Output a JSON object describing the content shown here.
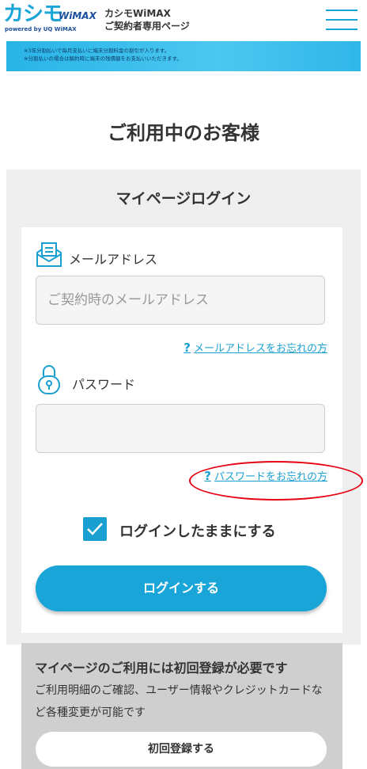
{
  "header": {
    "logo_main": "カシモ",
    "logo_wimax": "WiMAX",
    "logo_sub": "powered by UQ WiMAX",
    "site_title_line1": "カシモWiMAX",
    "site_title_line2": "ご契約者専用ページ",
    "menu_icon": "hamburger-icon"
  },
  "banner": {
    "line1": "※3年分割払いで毎月支払いに端末分割料金の割引が入ります。",
    "line2": "※分割払いの場合は解約時に端末の残債額をお支払いいただきます。"
  },
  "page_title": "ご利用中のお客様",
  "login": {
    "title": "マイページログイン",
    "email_label": "メールアドレス",
    "email_icon": "mail-icon",
    "email_placeholder": "ご契約時のメールアドレス",
    "email_value": "",
    "forgot_email": "メールアドレスをお忘れの方",
    "password_label": "パスワード",
    "password_icon": "lock-icon",
    "password_value": "",
    "forgot_password": "パスワードをお忘れの方",
    "remember_label": "ログインしたままにする",
    "remember_checked": true,
    "login_button": "ログインする"
  },
  "registration": {
    "title": "マイページのご利用には初回登録が必要です",
    "text": "ご利用明細のご確認、ユーザー情報やクレジットカードなど各種変更が可能です",
    "button": "初回登録する"
  },
  "colors": {
    "accent": "#1aa5d8",
    "highlight": "#e60012"
  }
}
